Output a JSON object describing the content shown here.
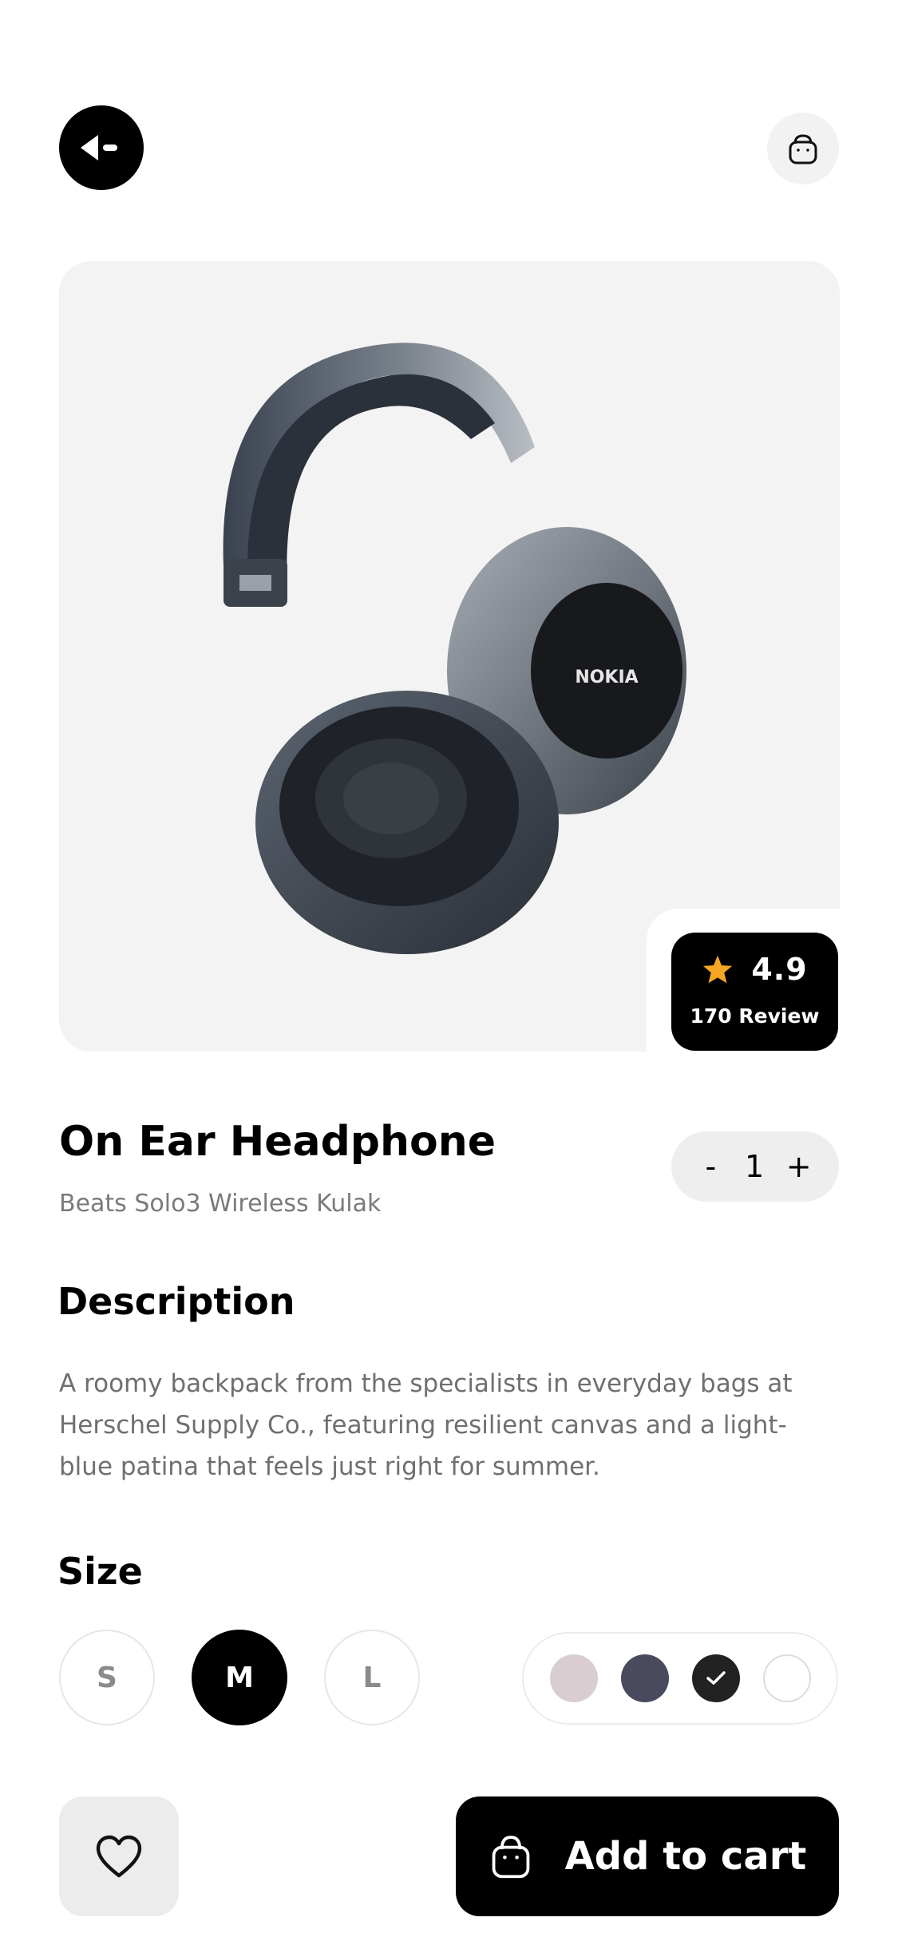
{
  "header": {
    "back_icon": "back-arrow-icon",
    "bag_icon": "shopping-bag-icon"
  },
  "product": {
    "brand_mark": "NOKIA",
    "rating": "4.9",
    "reviews": "170 Review",
    "title": "On Ear Headphone",
    "subtitle": "Beats Solo3 Wireless Kulak"
  },
  "quantity": {
    "minus": "-",
    "value": "1",
    "plus": "+"
  },
  "description": {
    "heading": "Description",
    "text": "A roomy backpack from the specialists in everyday bags at Herschel Supply Co., featuring resilient canvas and a light-blue patina that feels just right for summer."
  },
  "size": {
    "heading": "Size",
    "options": [
      "S",
      "M",
      "L"
    ],
    "selected": "M"
  },
  "colors": {
    "swatches": [
      "#d9cdd2",
      "#4a4a5e",
      "#222222",
      "#ffffff"
    ],
    "selected_index": 2
  },
  "actions": {
    "wishlist_icon": "heart-icon",
    "add_to_cart_label": "Add to cart",
    "add_to_cart_icon": "shopping-bag-icon"
  },
  "theme": {
    "accent": "#000000",
    "star": "#f5a623",
    "card_bg": "#f3f3f3"
  }
}
